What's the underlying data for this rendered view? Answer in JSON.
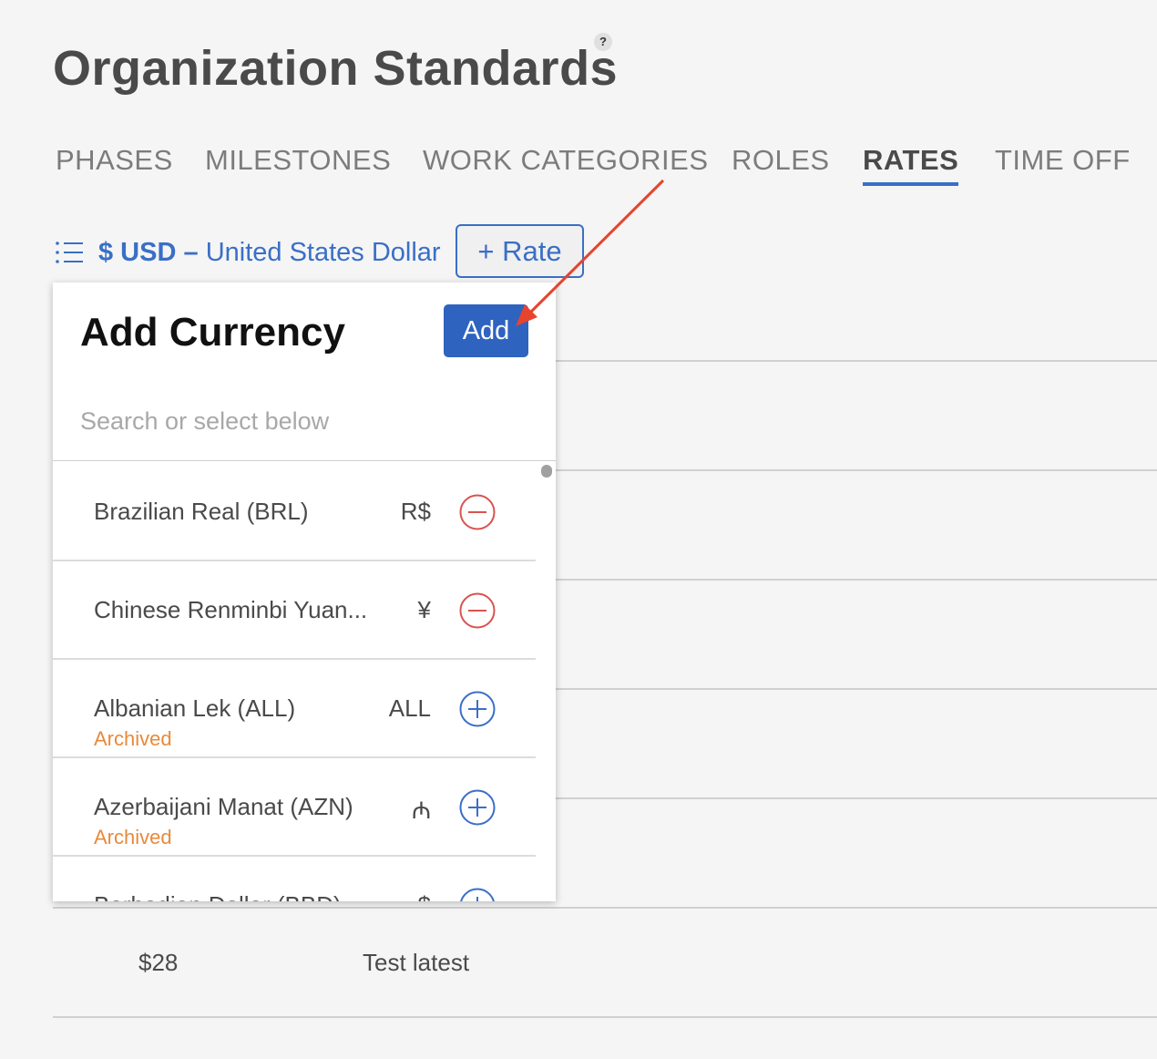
{
  "page": {
    "title": "Organization Standards",
    "help_label": "?"
  },
  "tabs": [
    {
      "label": "PHASES",
      "active": false
    },
    {
      "label": "MILESTONES",
      "active": false
    },
    {
      "label": "WORK CATEGORIES",
      "active": false
    },
    {
      "label": "ROLES",
      "active": false
    },
    {
      "label": "RATES",
      "active": true
    },
    {
      "label": "TIME OFF",
      "active": false
    }
  ],
  "currency_selector": {
    "code": "$ USD",
    "separator": "–",
    "name": "United States Dollar"
  },
  "rate_button_label": "+ Rate",
  "background_row": {
    "amount": "$28",
    "name": "Test latest"
  },
  "add_currency_panel": {
    "title": "Add Currency",
    "add_label": "Add",
    "search_placeholder": "Search or select below",
    "search_value": "",
    "items": [
      {
        "name": "Brazilian Real (BRL)",
        "symbol": "R$",
        "status": "",
        "action": "remove"
      },
      {
        "name": "Chinese Renminbi Yuan...",
        "symbol": "¥",
        "status": "",
        "action": "remove"
      },
      {
        "name": "Albanian Lek (ALL)",
        "symbol": "ALL",
        "status": "Archived",
        "action": "add"
      },
      {
        "name": "Azerbaijani Manat (AZN)",
        "symbol": "₼",
        "status": "Archived",
        "action": "add"
      },
      {
        "name": "Barbadian Dollar (BBD)",
        "symbol": "$",
        "status": "",
        "action": "add"
      }
    ]
  },
  "colors": {
    "accent": "#3a6fc6",
    "add_button": "#2e63c0",
    "remove": "#d9534f",
    "archived": "#e88a3a",
    "annotation_arrow": "#e8432d"
  },
  "icons": {
    "list": "list-icon",
    "remove": "minus-circle-icon",
    "add": "plus-circle-icon",
    "help": "help-icon"
  }
}
